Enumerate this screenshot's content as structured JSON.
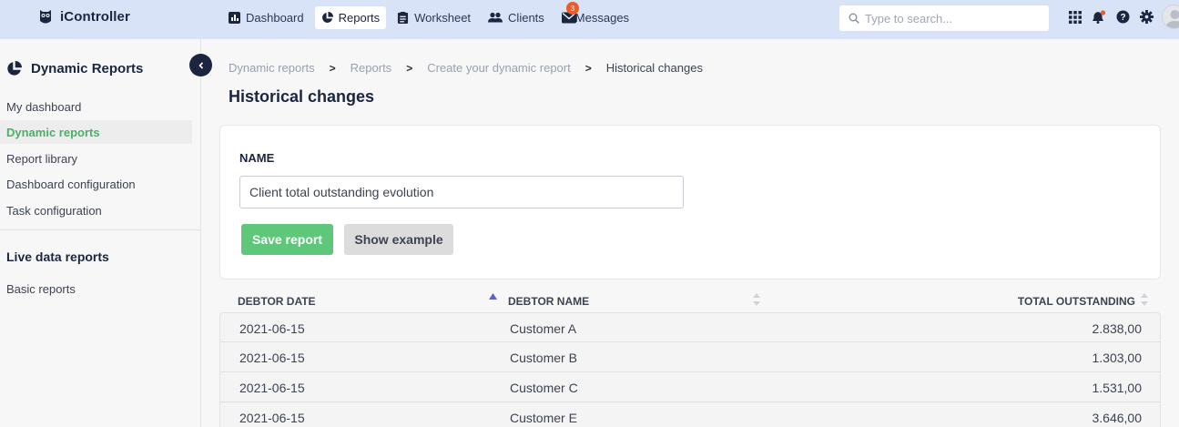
{
  "app": {
    "name": "iController"
  },
  "nav": {
    "items": [
      {
        "label": "Dashboard",
        "icon": "chart-icon"
      },
      {
        "label": "Reports",
        "icon": "pie-chart-icon",
        "active": true
      },
      {
        "label": "Worksheet",
        "icon": "clipboard-icon"
      },
      {
        "label": "Clients",
        "icon": "users-icon"
      },
      {
        "label": "Messages",
        "icon": "envelope-icon",
        "badge": "3"
      }
    ]
  },
  "search": {
    "placeholder": "Type to search..."
  },
  "sidebar": {
    "title": "Dynamic Reports",
    "items": [
      {
        "label": "My dashboard"
      },
      {
        "label": "Dynamic reports",
        "active": true
      },
      {
        "label": "Report library"
      },
      {
        "label": "Dashboard configuration"
      },
      {
        "label": "Task configuration"
      }
    ],
    "section_title": "Live data reports",
    "section_items": [
      {
        "label": "Basic reports"
      }
    ]
  },
  "breadcrumb": [
    "Dynamic reports",
    "Reports",
    "Create your dynamic report",
    "Historical changes"
  ],
  "page": {
    "title": "Historical changes"
  },
  "form": {
    "name_label": "NAME",
    "name_value": "Client total outstanding evolution",
    "save_label": "Save report",
    "example_label": "Show example"
  },
  "table": {
    "headers": [
      "DEBTOR DATE",
      "DEBTOR NAME",
      "TOTAL OUTSTANDING"
    ],
    "rows": [
      [
        "2021-06-15",
        "Customer A",
        "2.838,00"
      ],
      [
        "2021-06-15",
        "Customer B",
        "1.303,00"
      ],
      [
        "2021-06-15",
        "Customer C",
        "1.531,00"
      ],
      [
        "2021-06-15",
        "Customer E",
        "3.646,00"
      ]
    ]
  },
  "colors": {
    "topbar": "#d8e3f7",
    "accent_green": "#5fc77a",
    "navy": "#1b2540",
    "badge": "#f05a28"
  }
}
